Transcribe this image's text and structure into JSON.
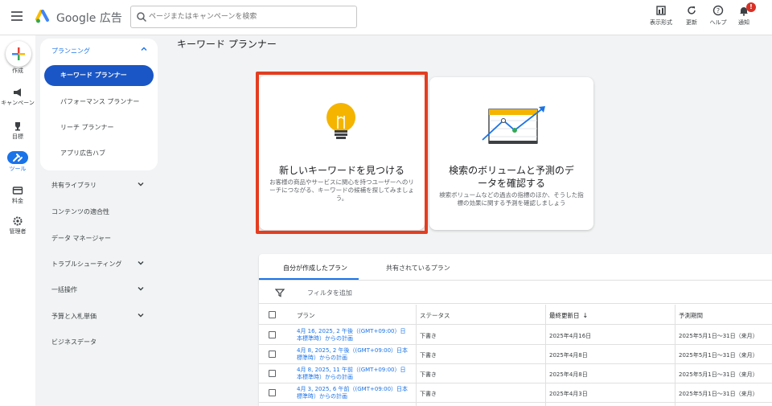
{
  "app": {
    "product_name": "Google 広告",
    "search_placeholder": "ページまたはキャンペーンを検索"
  },
  "toolbar": {
    "view": "表示形式",
    "refresh": "更新",
    "help": "ヘルプ",
    "notifications": "通知",
    "notification_count": "!"
  },
  "rail": {
    "create": "作成",
    "campaigns": "キャンペーン",
    "goals": "目標",
    "tools": "ツール",
    "billing": "料金",
    "admin": "管理者"
  },
  "nav": {
    "planning": "プランニング",
    "sub_items": [
      "キーワード プランナー",
      "パフォーマンス プランナー",
      "リーチ プランナー",
      "アプリ広告ハブ"
    ],
    "groups": [
      "共有ライブラリ",
      "コンテンツの適合性",
      "データ マネージャー",
      "トラブルシューティング",
      "一括操作",
      "予算と入札単価",
      "ビジネスデータ"
    ]
  },
  "main": {
    "page_title": "キーワード プランナー",
    "card_discover": {
      "title": "新しいキーワードを見つける",
      "description": "お客様の商品やサービスに関心を持つユーザーへのリーチにつながる、キーワードの候補を探してみましょう。"
    },
    "card_forecast": {
      "title_line1": "検索のボリュームと予測のデ",
      "title_line2": "ータを確認する",
      "description": "検索ボリュームなどの過去の指標のほか、そうした指標の効果に関する予測を確認しましょう"
    }
  },
  "plans": {
    "tabs": [
      "自分が作成したプラン",
      "共有されているプラン"
    ],
    "filter_label": "フィルタを追加",
    "columns": [
      "プラン",
      "ステータス",
      "最終更新日",
      "予測期間"
    ],
    "sort_indicator": "↓",
    "rows": [
      {
        "plan": "4月 16, 2025, 2 午後（(GMT+09:00）日本標準時）からの計画",
        "status": "下書き",
        "updated": "2025年4月16日",
        "period": "2025年5月1日～31日（来月）"
      },
      {
        "plan": "4月 8, 2025, 2 午後（(GMT+09:00）日本標準時）からの計画",
        "status": "下書き",
        "updated": "2025年4月8日",
        "period": "2025年5月1日～31日（来月）"
      },
      {
        "plan": "4月 8, 2025, 11 午前（(GMT+09:00）日本標準時）からの計画",
        "status": "下書き",
        "updated": "2025年4月8日",
        "period": "2025年5月1日～31日（来月）"
      },
      {
        "plan": "4月 3, 2025, 6 午前（(GMT+09:00）日本標準時）からの計画",
        "status": "下書き",
        "updated": "2025年4月3日",
        "period": "2025年5月1日～31日（来月）"
      }
    ]
  },
  "colors": {
    "accent": "#1a73e8",
    "nav_active": "#1a56c5",
    "highlight_frame": "#e43d20",
    "bulb": "#f4b400"
  }
}
